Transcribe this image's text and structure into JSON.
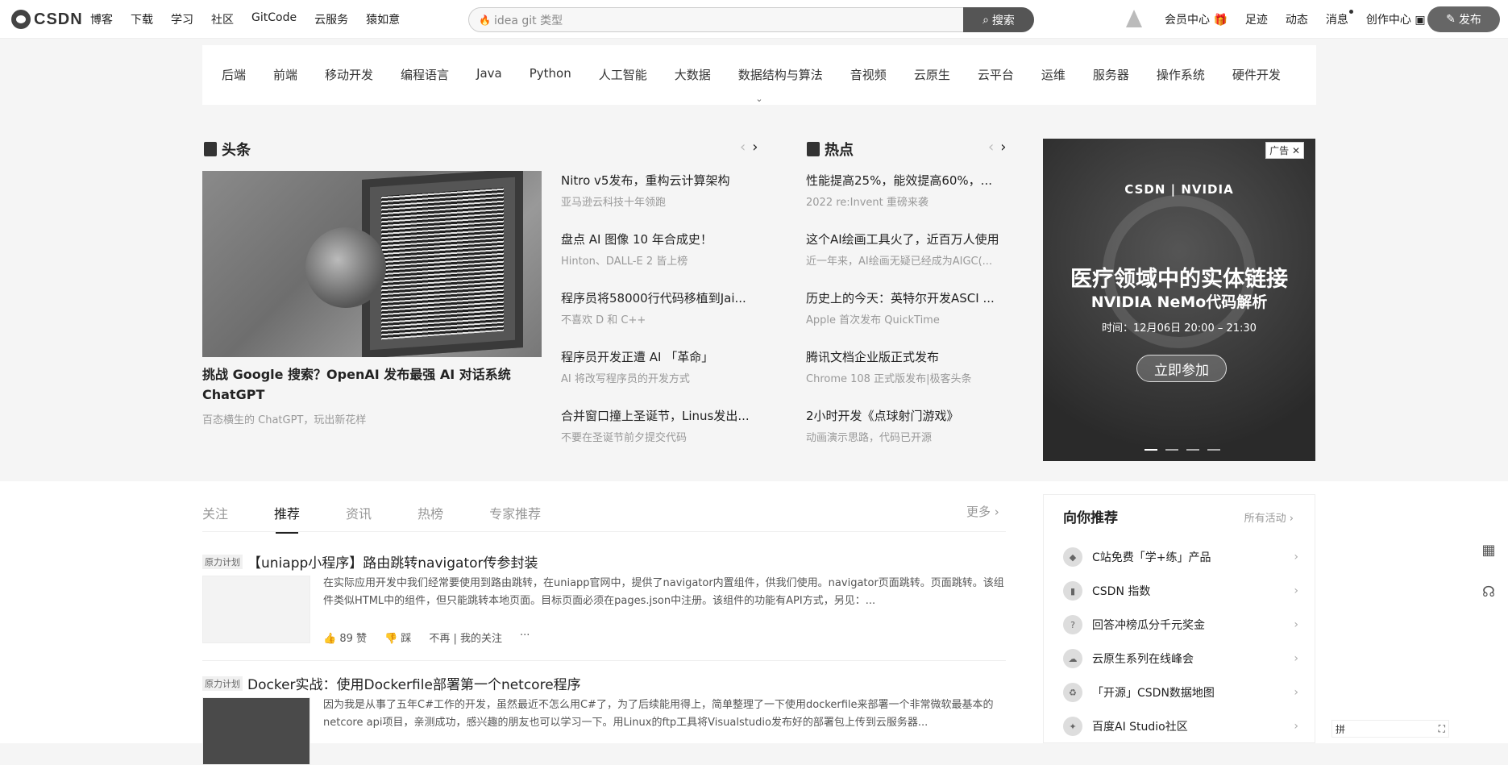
{
  "header": {
    "logo_text": "CSDN",
    "nav": [
      "博客",
      "下载",
      "学习",
      "社区",
      "GitCode",
      "云服务",
      "猿如意"
    ],
    "search_placeholder": "idea git 类型",
    "search_button": "搜索",
    "right_nav": [
      "会员中心",
      "足迹",
      "动态",
      "消息",
      "创作中心"
    ],
    "publish_label": "发布"
  },
  "categories": [
    "后端",
    "前端",
    "移动开发",
    "编程语言",
    "Java",
    "Python",
    "人工智能",
    "大数据",
    "数据结构与算法",
    "音视频",
    "云原生",
    "云平台",
    "运维",
    "服务器",
    "操作系统",
    "硬件开发"
  ],
  "headline": {
    "title": "头条",
    "hero_title": "挑战 Google 搜索？OpenAI 发布最强 AI 对话系统 ChatGPT",
    "hero_sub": "百态横生的 ChatGPT，玩出新花样",
    "items": [
      {
        "title": "Nitro v5发布，重构云计算架构",
        "sub": "亚马逊云科技十年领跑"
      },
      {
        "title": "盘点 AI 图像 10 年合成史！",
        "sub": "Hinton、DALL-E 2 皆上榜"
      },
      {
        "title": "程序员将58000行代码移植到Jai...",
        "sub": "不喜欢 D 和 C++"
      },
      {
        "title": "程序员开发正遭 AI 「革命」",
        "sub": "AI 将改写程序员的开发方式"
      },
      {
        "title": "合并窗口撞上圣诞节，Linus发出...",
        "sub": "不要在圣诞节前夕提交代码"
      }
    ]
  },
  "hot": {
    "title": "热点",
    "items": [
      {
        "title": "性能提高25%，能效提高60%，...",
        "sub": "2022 re:Invent 重磅来袭"
      },
      {
        "title": "这个AI绘画工具火了，近百万人使用",
        "sub": "近一年来，AI绘画无疑已经成为AIGC(..."
      },
      {
        "title": "历史上的今天：英特尔开发ASCI ...",
        "sub": "Apple 首次发布 QuickTime"
      },
      {
        "title": "腾讯文档企业版正式发布",
        "sub": "Chrome 108 正式版发布|极客头条"
      },
      {
        "title": "2小时开发《点球射门游戏》",
        "sub": "动画演示思路，代码已开源"
      }
    ]
  },
  "ad": {
    "tag": "广告",
    "brands": "CSDN | NVIDIA",
    "headline": "医疗领域中的实体链接",
    "subheadline": "NVIDIA NeMo代码解析",
    "time": "时间：12月06日 20:00 – 21:30",
    "button": "立即参加"
  },
  "feed": {
    "tabs": [
      "关注",
      "推荐",
      "资讯",
      "热榜",
      "专家推荐"
    ],
    "active_tab": "推荐",
    "more": "更多",
    "articles": [
      {
        "badge": "原力计划",
        "title": "【uniapp小程序】路由跳转navigator传参封装",
        "desc": "在实际应用开发中我们经常要使用到路由跳转，在uniapp官网中，提供了navigator内置组件，供我们使用。navigator页面跳转。页面跳转。该组件类似HTML中的组件，但只能跳转本地页面。目标页面必须在pages.json中注册。该组件的功能有API方式，另见：...",
        "likes": "89 赞",
        "dislike": "踩",
        "not_interested": "不再",
        "my_follow": "我的关注",
        "ellipsis": "···"
      },
      {
        "badge": "原力计划",
        "title": "Docker实战：使用Dockerfile部署第一个netcore程序",
        "desc": "因为我是从事了五年C#工作的开发，虽然最近不怎么用C#了，为了后续能用得上，简单整理了一下使用dockerfile来部署一个非常微软最基本的netcore api项目，亲测成功，感兴趣的朋友也可以学习一下。用Linux的ftp工具将Visualstudio发布好的部署包上传到云服务器..."
      }
    ]
  },
  "recommend": {
    "title": "向你推荐",
    "all": "所有活动",
    "items": [
      "C站免费「学+练」产品",
      "CSDN 指数",
      "回答冲榜瓜分千元奖金",
      "云原生系列在线峰会",
      "「开源」CSDN数据地图",
      "百度AI Studio社区"
    ]
  },
  "ime": {
    "label": "拼"
  }
}
